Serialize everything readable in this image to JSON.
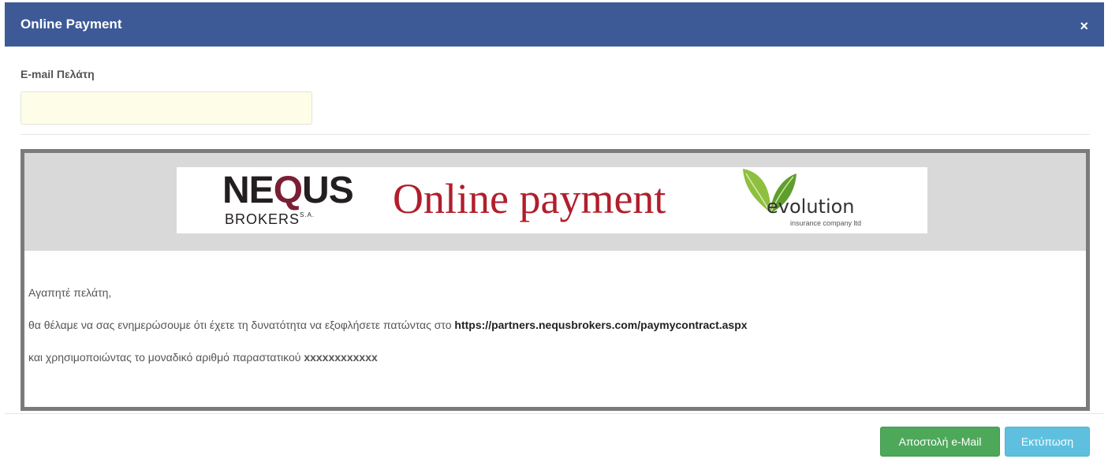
{
  "modal": {
    "title": "Online Payment",
    "close_glyph": "×"
  },
  "form": {
    "email_label": "E-mail Πελάτη",
    "email_value": "",
    "email_placeholder": ""
  },
  "banner": {
    "nequs_logo_text_1": "NE",
    "nequs_logo_text_q": "Q",
    "nequs_logo_text_2": "US",
    "brokers_text": "BROKERS",
    "brokers_suffix": "S.A.",
    "title": "Online payment",
    "evolution_text": "evolution",
    "evolution_sub": "insurance company ltd"
  },
  "message": {
    "greeting": "Αγαπητέ πελάτη,",
    "line1_prefix": "θα θέλαμε να σας ενημερώσουμε ότι έχετε τη δυνατότητα να εξοφλήσετε πατώντας στο ",
    "line1_link": "https://partners.nequsbrokers.com/paymycontract.aspx",
    "line2_prefix": "και χρησιμοποιώντας το μοναδικό αριθμό παραστατικού ",
    "line2_ref": "xxxxxxxxxxxx"
  },
  "buttons": {
    "send_email": "Αποστολή e-Mail",
    "print": "Εκτύπωση"
  },
  "colors": {
    "header_bg": "#3d5a96",
    "send_button": "#4ea85a",
    "print_button": "#5ec0de",
    "banner_red": "#b11e2b"
  },
  "icons": [
    "close-icon",
    "leaf-icon"
  ]
}
